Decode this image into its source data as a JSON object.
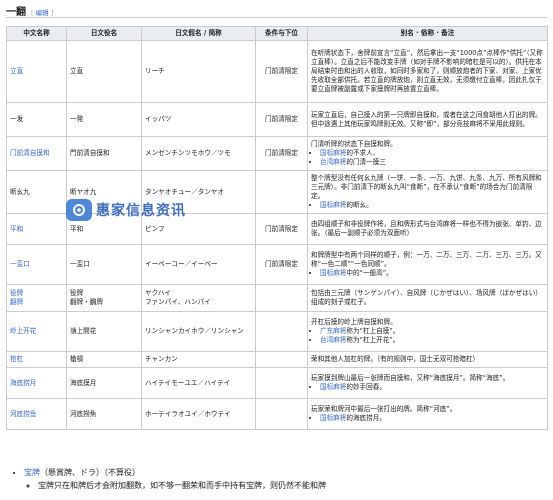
{
  "section": {
    "title": "一翻",
    "edit_open": "[",
    "edit_label": "编辑",
    "edit_close": "]"
  },
  "table": {
    "headers": [
      "中文名称",
      "日文役名",
      "日文假名 / 简称",
      "条件与下位",
      "别名 · 俗称 · 备注"
    ],
    "rows": [
      {
        "name": "立直",
        "name_link": true,
        "jp": "立直",
        "kana": "リーチ",
        "cond": "门前清限定",
        "notes": [
          "在听牌状态下，舍牌前宣言“立直”，然后拿出一支“1000点”点棒作“供托”（又称立直棒）。立直之后不能改变手牌（如对手牌不影响的暗杠是可以的）。供托在本局结束时由和出的人收取，如同时多家和了，则顺放炮者的下家、对家、上家优先收取全部供托。若立直的牌放炮，则立直无效，无须缴付立直棒，因此扎仅于要立直牌被副露或下家摸牌时再放置立直棒。"
        ],
        "list": []
      },
      {
        "name": "一发",
        "name_link": false,
        "jp": "一発",
        "kana": "イッパツ",
        "cond": "门前清限定",
        "notes": [
          "玩家立直后，自己摸入的第一只牌即自摸和，或者在这之间食胡他人打出的牌。但中途遇上其他玩家鸣牌则无效。又称“即”，部分竞技麻将不采用此规则。"
        ],
        "list": []
      },
      {
        "name": "门前清自摸和",
        "name_link": true,
        "jp": "門前清自摸和",
        "kana": "メンゼンチンツモホウ／ツモ",
        "cond": "门前清限定",
        "notes": [
          "门清听牌的状态下自摸和牌。"
        ],
        "list": [
          {
            "pre": "",
            "link": "国标麻将",
            "post": "的不求人、"
          },
          {
            "pre": "",
            "link": "台湾麻将",
            "post": "的门清一摸三"
          }
        ]
      },
      {
        "name": "断幺九",
        "name_link": false,
        "jp": "断ヤオ九",
        "kana": "タンヤオチュー／タンヤオ",
        "cond": "",
        "notes": [
          "整个牌型没有任何幺九牌（一饼、一条、一万、九饼、九条、九万、所有风牌和三元牌）。非门前清下的断幺九叫“食断”，在不承认“食断”的场合为门前清限定。"
        ],
        "list": [
          {
            "pre": "",
            "link": "国标麻将",
            "post": "的断幺。"
          }
        ]
      },
      {
        "name": "平和",
        "name_link": true,
        "jp": "平和",
        "kana": "ピンフ",
        "cond": "门前清限定",
        "notes": [
          "由四组顺子和非役牌作将，且和牌形式与台湾麻将一样也不得为嵌张、单钓、边张。（最后一副顺子必须为双面听）"
        ],
        "list": []
      },
      {
        "name": "一盃口",
        "name_link": true,
        "jp": "一盃口",
        "kana": "イーペーコー／イーペー",
        "cond": "门前清限定",
        "notes": [
          "和牌牌型中有两个同样的顺子，例：一万、二万、三万、二万、三万、三万。又称“一色二顺”“一色同顺”。"
        ],
        "list": [
          {
            "pre": "",
            "link": "国标麻将",
            "post": "中的“一般高”。"
          }
        ]
      },
      {
        "name": "役牌\n翻牌",
        "name_link": true,
        "jp": "役牌\n翻牌・飜牌",
        "kana": "ヤクハイ\nファンパイ、ハンパイ",
        "cond": "",
        "notes": [
          "包括由三元牌（サンゲンパイ）、自风牌（じかぜはい）、场风牌（ばかぜはい）组成的刻子或杠子。"
        ],
        "list": []
      },
      {
        "name": "岭上开花",
        "name_link": true,
        "jp": "嶺上開花",
        "kana": "リンシャンカイホウ／リンシャン",
        "cond": "",
        "notes": [
          "开杠后摸的岭上牌自摸和牌。"
        ],
        "list": [
          {
            "pre": "",
            "link": "广东麻将",
            "post": "称为“杠上自摸”。"
          },
          {
            "pre": "",
            "link": "台湾麻将",
            "post": "称为“杠上开花”。"
          }
        ]
      },
      {
        "name": "抢杠",
        "name_link": true,
        "jp": "槍槓",
        "kana": "チャンカン",
        "cond": "",
        "notes": [
          "荣和其他人加杠的牌。（有的规则中，国士无双可抢暗杠）"
        ],
        "list": []
      },
      {
        "name": "海底捞月",
        "name_link": true,
        "jp": "海底摸月",
        "kana": "ハイテイモーユエ／ハイテイ",
        "cond": "",
        "notes": [
          "玩家摸到牌山最后一张牌而自摸和，又称“海底摸月”。简称“海底”。"
        ],
        "list": [
          {
            "pre": "",
            "link": "国标麻将",
            "post": "的妙手回春。"
          }
        ]
      },
      {
        "name": "河底捞鱼",
        "name_link": true,
        "jp": "河底撈魚",
        "kana": "ホーテイラオユイ／ホウテイ",
        "cond": "",
        "notes": [
          "玩家荣和牌河中最后一张打出的牌。简称“河底”。"
        ],
        "list": [
          {
            "pre": "",
            "link": "国标麻将",
            "post": "的海底捞月。"
          }
        ]
      }
    ]
  },
  "watermark": {
    "text": "惠家信息资讯"
  },
  "footer": {
    "item_link": "宝牌",
    "item_rest": "（懸賞牌、ドラ）（不算役）",
    "sub": "宝牌只在和牌后才会附加翻数，如不够一翻荣和而手中持有宝牌，则仍然不能和牌"
  }
}
